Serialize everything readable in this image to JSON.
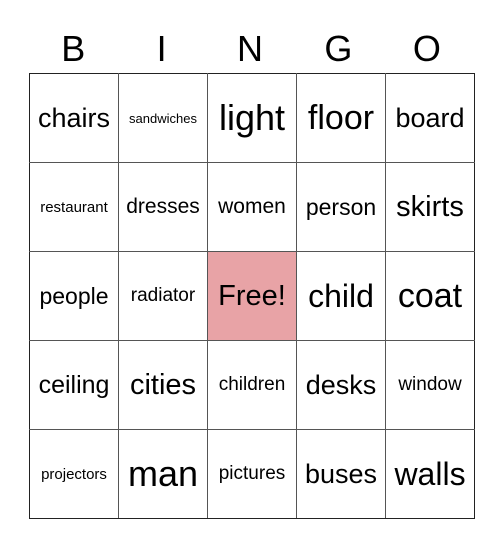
{
  "header": [
    "B",
    "I",
    "N",
    "G",
    "O"
  ],
  "free_color": "#e8a3a6",
  "rows": [
    [
      "chairs",
      "sandwiches",
      "light",
      "floor",
      "board"
    ],
    [
      "restaurant",
      "dresses",
      "women",
      "person",
      "skirts"
    ],
    [
      "people",
      "radiator",
      "Free!",
      "child",
      "coat"
    ],
    [
      "ceiling",
      "cities",
      "children",
      "desks",
      "window"
    ],
    [
      "projectors",
      "man",
      "pictures",
      "buses",
      "walls"
    ]
  ]
}
